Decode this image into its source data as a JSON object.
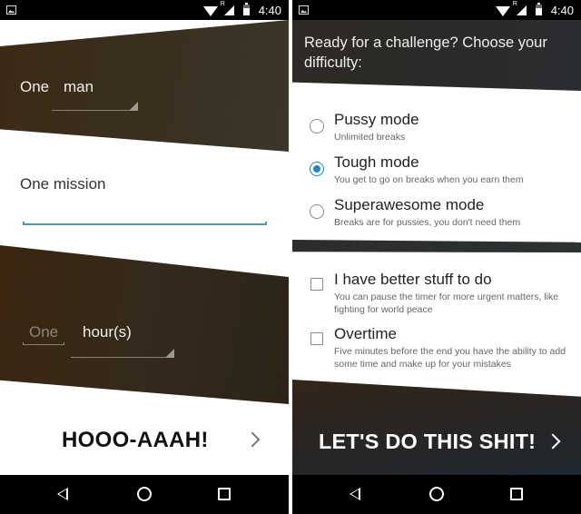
{
  "status_bar": {
    "time": "4:40",
    "icons": [
      "image-notification-icon",
      "wifi-icon",
      "signal-icon",
      "battery-icon"
    ],
    "signal_label": "R"
  },
  "nav_bar": {
    "icons": [
      "back-icon",
      "home-icon",
      "recents-icon"
    ]
  },
  "left_screen": {
    "who": {
      "label": "One",
      "spinner_value": "man"
    },
    "mission": {
      "value": "One mission",
      "accent_color": "#3f9fb5"
    },
    "duration": {
      "amount_placeholder": "One",
      "unit_value": "hour(s)"
    },
    "cta": {
      "label": "HOOO-AAAH!",
      "icon": "chevron-right-icon"
    }
  },
  "right_screen": {
    "title": "Ready for a challenge? Choose your difficulty:",
    "difficulty_options": [
      {
        "title": "Pussy mode",
        "subtitle": "Unlimited breaks",
        "selected": false
      },
      {
        "title": "Tough mode",
        "subtitle": "You get to go on breaks when you earn them",
        "selected": true
      },
      {
        "title": "Superawesome mode",
        "subtitle": "Breaks are for pussies, you don't need them",
        "selected": false
      }
    ],
    "extra_options": [
      {
        "title": "I have better stuff to do",
        "subtitle": "You can pause the timer for more urgent matters, like fighting for world peace",
        "checked": false
      },
      {
        "title": "Overtime",
        "subtitle": "Five minutes before the end you have the ability to add some time and make up for your mistakes",
        "checked": false
      }
    ],
    "accent_color": "#1e88c8",
    "cta": {
      "label": "LET'S DO THIS SHIT!",
      "icon": "chevron-right-icon"
    }
  }
}
